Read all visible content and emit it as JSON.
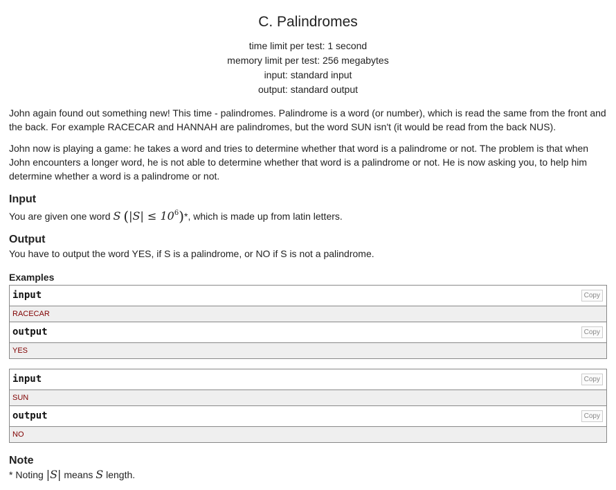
{
  "problem": {
    "title": "C. Palindromes",
    "time_limit": "time limit per test: 1 second",
    "memory_limit": "memory limit per test: 256 megabytes",
    "input_file": "input: standard input",
    "output_file": "output: standard output"
  },
  "statement": {
    "p1": "John again found out something new! This time - palindromes. Palindrome is a word (or number), which is read the same from the front and the back. For example RACECAR and HANNAH are palindromes, but the word SUN isn't (it would be read from the back NUS).",
    "p2": "John now is playing a game: he takes a word and tries to determine whether that word is a palindrome or not. The problem is that when John encounters a longer word, he is not able to determine whether that word is a palindrome or not. He is now asking you, to help him determine whether a word is a palindrome or not."
  },
  "input_section": {
    "title": "Input",
    "text_before": "You are given one word ",
    "math_s": "S",
    "math_len": "|S| ≤ 10",
    "math_exp": "6",
    "text_after": "*, which is made up from latin letters."
  },
  "output_section": {
    "title": "Output",
    "text": "You have to output the word YES, if S is a palindrome, or NO if S is not a palindrome."
  },
  "examples": {
    "label": "Examples",
    "input_label": "input",
    "output_label": "output",
    "copy_label": "Copy",
    "items": [
      {
        "input": "RACECAR",
        "output": "YES"
      },
      {
        "input": "SUN",
        "output": "NO"
      }
    ]
  },
  "note": {
    "title": "Note",
    "prefix": "* Noting ",
    "math_abs": "|S|",
    "middle": " means ",
    "math_s": "S",
    "suffix": " length."
  }
}
